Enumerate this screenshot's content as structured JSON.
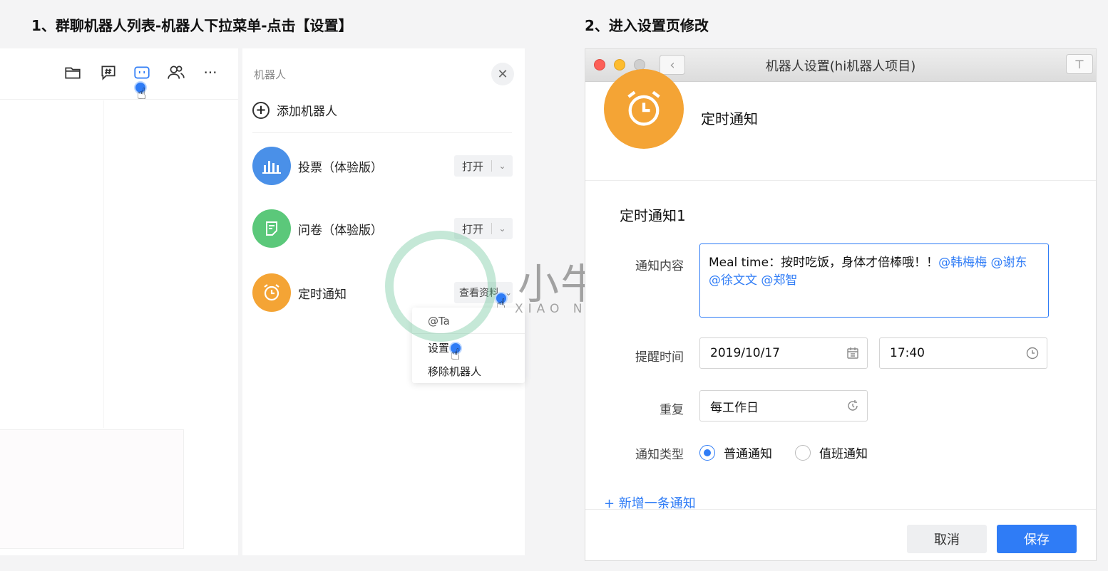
{
  "steps": {
    "step1": "1、群聊机器人列表-机器人下拉菜单-点击【设置】",
    "step2": "2、进入设置页修改"
  },
  "chat_toolbar": {
    "icons": [
      "folder-icon",
      "topic-icon",
      "robot-icon",
      "members-icon",
      "more-icon"
    ],
    "more_label": "···"
  },
  "bot_panel": {
    "title": "机器人",
    "close": "✕",
    "add_bot": "添加机器人",
    "add_plus": "+",
    "bots": [
      {
        "name": "投票（体验版）",
        "action": "打开",
        "color": "#4a90e8"
      },
      {
        "name": "问卷（体验版）",
        "action": "打开",
        "color": "#5bc87a"
      },
      {
        "name": "定时通知",
        "action": "查看资料",
        "color": "#f4a435"
      }
    ],
    "dropdown": {
      "items": [
        "@Ta",
        "设置",
        "移除机器人"
      ]
    }
  },
  "watermark": {
    "text": "小牛知识库",
    "sub": "XIAO NIU ZHI SHI KU"
  },
  "settings_window": {
    "title": "机器人设置(hi机器人项目)",
    "back": "‹",
    "pin": "⊤",
    "bot_name": "定时通知",
    "section_title": "定时通知1",
    "labels": {
      "content": "通知内容",
      "remind_time": "提醒时间",
      "repeat": "重复",
      "notice_type": "通知类型"
    },
    "content_text": "Meal time：按时吃饭，身体才倍棒哦！！",
    "mentions": [
      "@韩梅梅",
      "@谢东",
      "@徐文文",
      "@郑智"
    ],
    "date": "2019/10/17",
    "time": "17:40",
    "repeat_value": "每工作日",
    "notice_types": [
      {
        "label": "普通通知",
        "selected": true
      },
      {
        "label": "值班通知",
        "selected": false
      }
    ],
    "add_notice": "+ 新增一条通知",
    "cancel": "取消",
    "save": "保存"
  },
  "colors": {
    "accent": "#2f7cf6",
    "orange": "#f4a435"
  }
}
